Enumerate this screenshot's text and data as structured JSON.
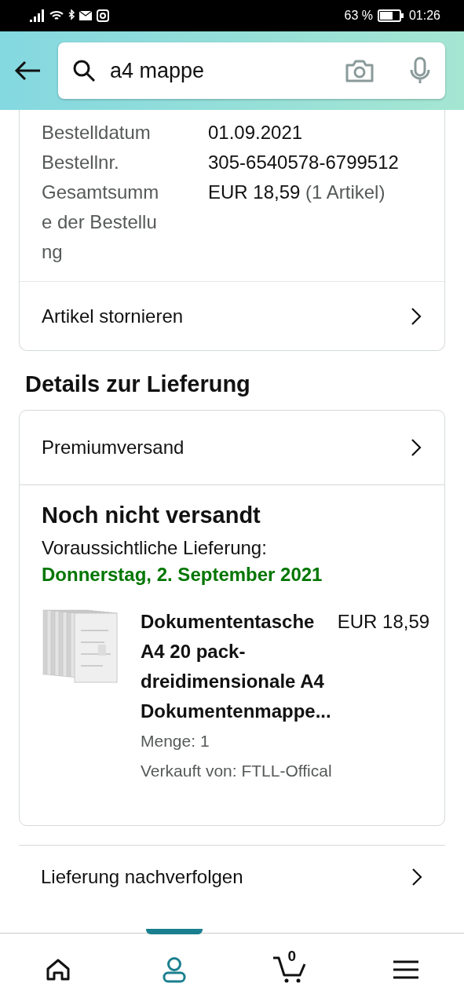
{
  "status_bar": {
    "battery": "63 %",
    "time": "01:26"
  },
  "search": {
    "value": "a4 mappe"
  },
  "order_info": {
    "rows": [
      {
        "label": "Bestelldatum",
        "value": "01.09.2021"
      },
      {
        "label": "Bestellnr.",
        "value": "305-6540578-6799512"
      },
      {
        "label": "Gesamtsumme der Bestellung",
        "value": "EUR 18,59",
        "note": "(1 Artikel)"
      }
    ],
    "action": "Artikel stornieren"
  },
  "delivery": {
    "heading": "Details zur Lieferung",
    "shipping": "Premiumversand",
    "status": "Noch nicht versandt",
    "expected_label": "Voraussichtliche Lieferung:",
    "expected_date": "Donnerstag, 2. September 2021",
    "item": {
      "kind": "picture",
      "title": "Dokumententasche A4 20 pack-dreidimensionale A4 Dokumentenmappe...",
      "price": "EUR 18,59",
      "quantity": "Menge: 1",
      "seller": "Verkauft von: FTLL-Offical"
    },
    "track": "Lieferung nachverfolgen"
  },
  "bottom_nav": [
    {
      "kind": "home",
      "selected": false
    },
    {
      "kind": "account",
      "selected": true
    },
    {
      "kind": "cart",
      "selected": false,
      "count": "0"
    },
    {
      "kind": "menu",
      "selected": false
    }
  ]
}
